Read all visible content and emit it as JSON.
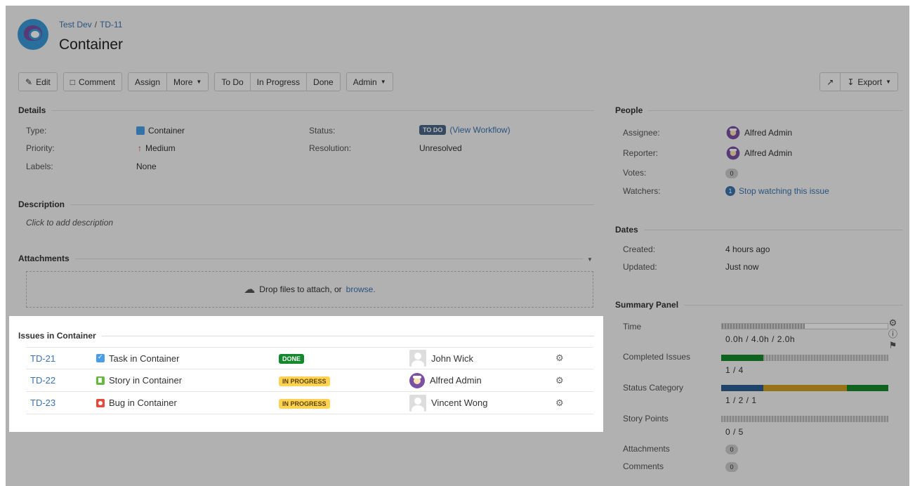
{
  "breadcrumb": {
    "project": "Test Dev",
    "separator": "/",
    "issue_key": "TD-11"
  },
  "issue": {
    "title": "Container"
  },
  "toolbar": {
    "edit": "Edit",
    "comment": "Comment",
    "assign": "Assign",
    "more": "More",
    "todo": "To Do",
    "in_progress": "In Progress",
    "done": "Done",
    "admin": "Admin",
    "export": "Export"
  },
  "details": {
    "heading": "Details",
    "type_label": "Type:",
    "type_value": "Container",
    "priority_label": "Priority:",
    "priority_value": "Medium",
    "labels_label": "Labels:",
    "labels_value": "None",
    "status_label": "Status:",
    "status_value": "TO DO",
    "workflow_link": "(View Workflow)",
    "resolution_label": "Resolution:",
    "resolution_value": "Unresolved"
  },
  "description": {
    "heading": "Description",
    "placeholder": "Click to add description"
  },
  "attachments": {
    "heading": "Attachments",
    "drop_text": "Drop files to attach, or",
    "browse": "browse."
  },
  "issues_in_container": {
    "heading": "Issues in Container",
    "rows": [
      {
        "key": "TD-21",
        "summary": "Task in Container",
        "type": "task",
        "status": "DONE",
        "assignee": "John Wick",
        "avatar": "blank"
      },
      {
        "key": "TD-22",
        "summary": "Story in Container",
        "type": "story",
        "status": "IN PROGRESS",
        "assignee": "Alfred Admin",
        "avatar": "alfred"
      },
      {
        "key": "TD-23",
        "summary": "Bug in Container",
        "type": "bug",
        "status": "IN PROGRESS",
        "assignee": "Vincent Wong",
        "avatar": "blank"
      }
    ]
  },
  "people": {
    "heading": "People",
    "assignee_label": "Assignee:",
    "assignee": "Alfred Admin",
    "reporter_label": "Reporter:",
    "reporter": "Alfred Admin",
    "votes_label": "Votes:",
    "votes": "0",
    "watchers_label": "Watchers:",
    "watchers_count": "1",
    "watch_link": "Stop watching this issue"
  },
  "dates": {
    "heading": "Dates",
    "created_label": "Created:",
    "created": "4 hours ago",
    "updated_label": "Updated:",
    "updated": "Just now"
  },
  "summary_panel": {
    "heading": "Summary Panel",
    "time_label": "Time",
    "time_value": "0.0h / 4.0h / 2.0h",
    "completed_label": "Completed Issues",
    "completed_value": "1 / 4",
    "completed_fraction": 0.25,
    "status_category_label": "Status Category",
    "status_category_value": "1 / 2 / 1",
    "story_points_label": "Story Points",
    "story_points_value": "0 / 5",
    "attachments_label": "Attachments",
    "attachments_count": "0",
    "comments_label": "Comments",
    "comments_count": "0"
  },
  "colors": {
    "link": "#3b73af",
    "done_green": "#14892c",
    "in_progress_yellow": "#ffd351",
    "todo_blue": "#4a6785"
  }
}
